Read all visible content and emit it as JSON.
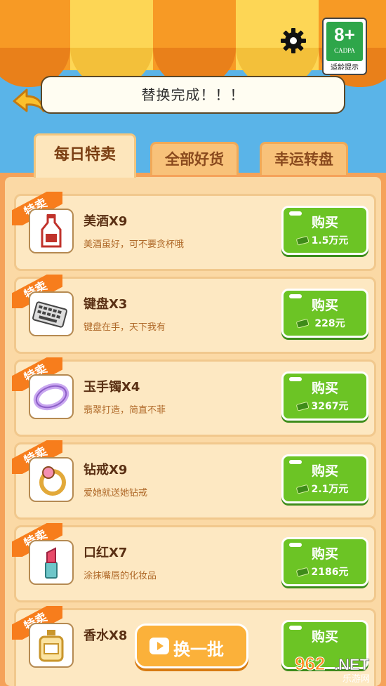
{
  "header": {
    "age_rating": {
      "number": "8+",
      "org": "CADPA",
      "caption": "适龄提示"
    }
  },
  "toast": {
    "message": "替换完成！！！"
  },
  "tabs": [
    {
      "label": "每日特卖",
      "active": true
    },
    {
      "label": "全部好货",
      "active": false
    },
    {
      "label": "幸运转盘",
      "active": false
    }
  ],
  "items": [
    {
      "badge": "特卖",
      "title": "美酒X9",
      "desc": "美酒虽好，可不要贪杯哦",
      "buy": "购买",
      "price": "1.5万元",
      "icon": "liquor-bottle-icon"
    },
    {
      "badge": "特卖",
      "title": "键盘X3",
      "desc": "键盘在手，天下我有",
      "buy": "购买",
      "price": "228元",
      "icon": "keyboard-icon"
    },
    {
      "badge": "特卖",
      "title": "玉手镯X4",
      "desc": "翡翠打造，简直不菲",
      "buy": "购买",
      "price": "3267元",
      "icon": "jade-bracelet-icon"
    },
    {
      "badge": "特卖",
      "title": "钻戒X9",
      "desc": "爱她就送她钻戒",
      "buy": "购买",
      "price": "2.1万元",
      "icon": "diamond-ring-icon"
    },
    {
      "badge": "特卖",
      "title": "口红X7",
      "desc": "涂抹嘴唇的化妆品",
      "buy": "购买",
      "price": "2186元",
      "icon": "lipstick-icon"
    },
    {
      "badge": "特卖",
      "title": "香水X8",
      "desc": "",
      "buy": "购买",
      "price": "",
      "icon": "perfume-icon"
    }
  ],
  "refresh_button": {
    "label": "换一批"
  },
  "watermark": {
    "brand": "962.NET",
    "sub": "乐游网"
  },
  "colors": {
    "sky": "#5ab4e8",
    "buy_green": "#6cc425",
    "ribbon_orange": "#f77d1c",
    "card": "#fde8c2"
  }
}
